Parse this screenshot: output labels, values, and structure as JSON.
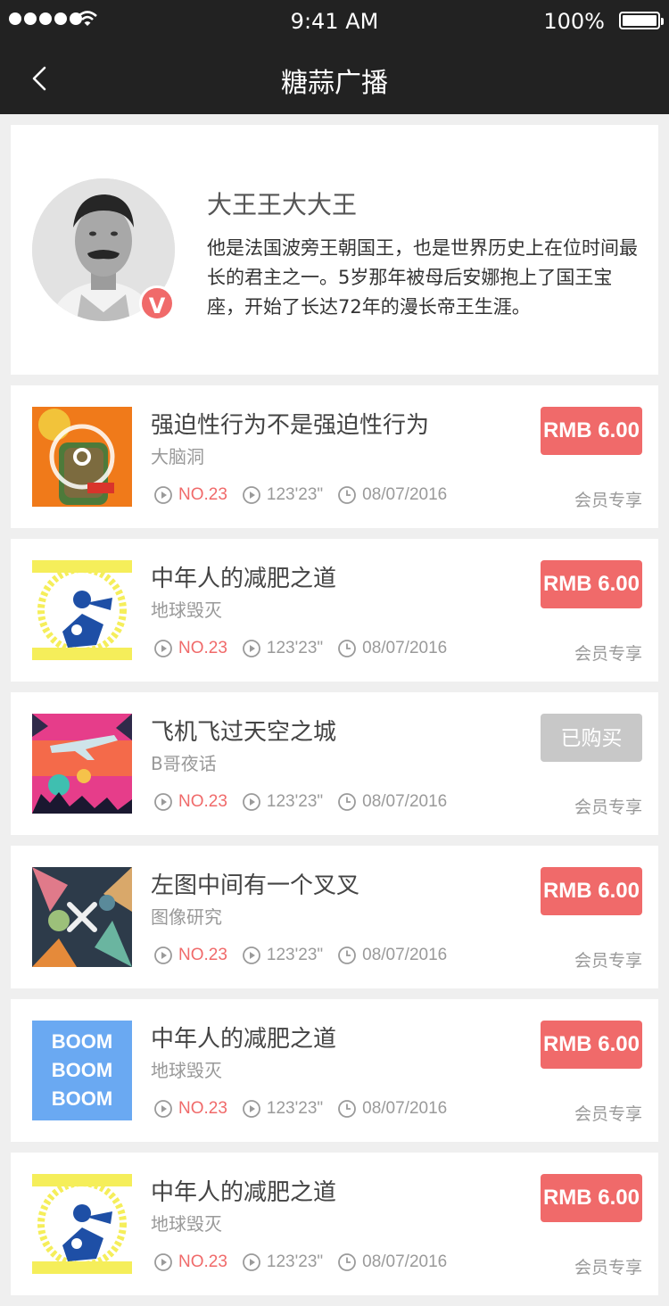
{
  "status": {
    "time": "9:41 AM",
    "battery": "100%"
  },
  "nav": {
    "title": "糖蒜广播"
  },
  "profile": {
    "name": "大王王大大王",
    "badge": "V",
    "desc": "他是法国波旁王朝国王，也是世界历史上在位时间最长的君主之一。5岁那年被母后安娜抱上了国王宝座，开始了长达72年的漫长帝王生涯。"
  },
  "items": [
    {
      "title": "强迫性行为不是强迫性行为",
      "sub": "大脑洞",
      "rank": "NO.23",
      "duration": "123'23\"",
      "date": "08/07/2016",
      "price": "RMB 6.00",
      "bought": false,
      "member": "会员专享",
      "thumb": "orange-illustration"
    },
    {
      "title": "中年人的减肥之道",
      "sub": "地球毁灭",
      "rank": "NO.23",
      "duration": "123'23\"",
      "date": "08/07/2016",
      "price": "RMB 6.00",
      "bought": false,
      "member": "会员专享",
      "thumb": "yellow-blue-illustration"
    },
    {
      "title": "飞机飞过天空之城",
      "sub": "B哥夜话",
      "rank": "NO.23",
      "duration": "123'23\"",
      "date": "08/07/2016",
      "price": "已购买",
      "bought": true,
      "member": "会员专享",
      "thumb": "pink-plane-illustration"
    },
    {
      "title": "左图中间有一个叉叉",
      "sub": "图像研究",
      "rank": "NO.23",
      "duration": "123'23\"",
      "date": "08/07/2016",
      "price": "RMB 6.00",
      "bought": false,
      "member": "会员专享",
      "thumb": "floral-x-illustration"
    },
    {
      "title": "中年人的减肥之道",
      "sub": "地球毁灭",
      "rank": "NO.23",
      "duration": "123'23\"",
      "date": "08/07/2016",
      "price": "RMB 6.00",
      "bought": false,
      "member": "会员专享",
      "thumb": "boom-text",
      "thumb_text": [
        "BOOM",
        "BOOM",
        "BOOM"
      ]
    },
    {
      "title": "中年人的减肥之道",
      "sub": "地球毁灭",
      "rank": "NO.23",
      "duration": "123'23\"",
      "date": "08/07/2016",
      "price": "RMB 6.00",
      "bought": false,
      "member": "会员专享",
      "thumb": "yellow-blue-illustration"
    }
  ]
}
